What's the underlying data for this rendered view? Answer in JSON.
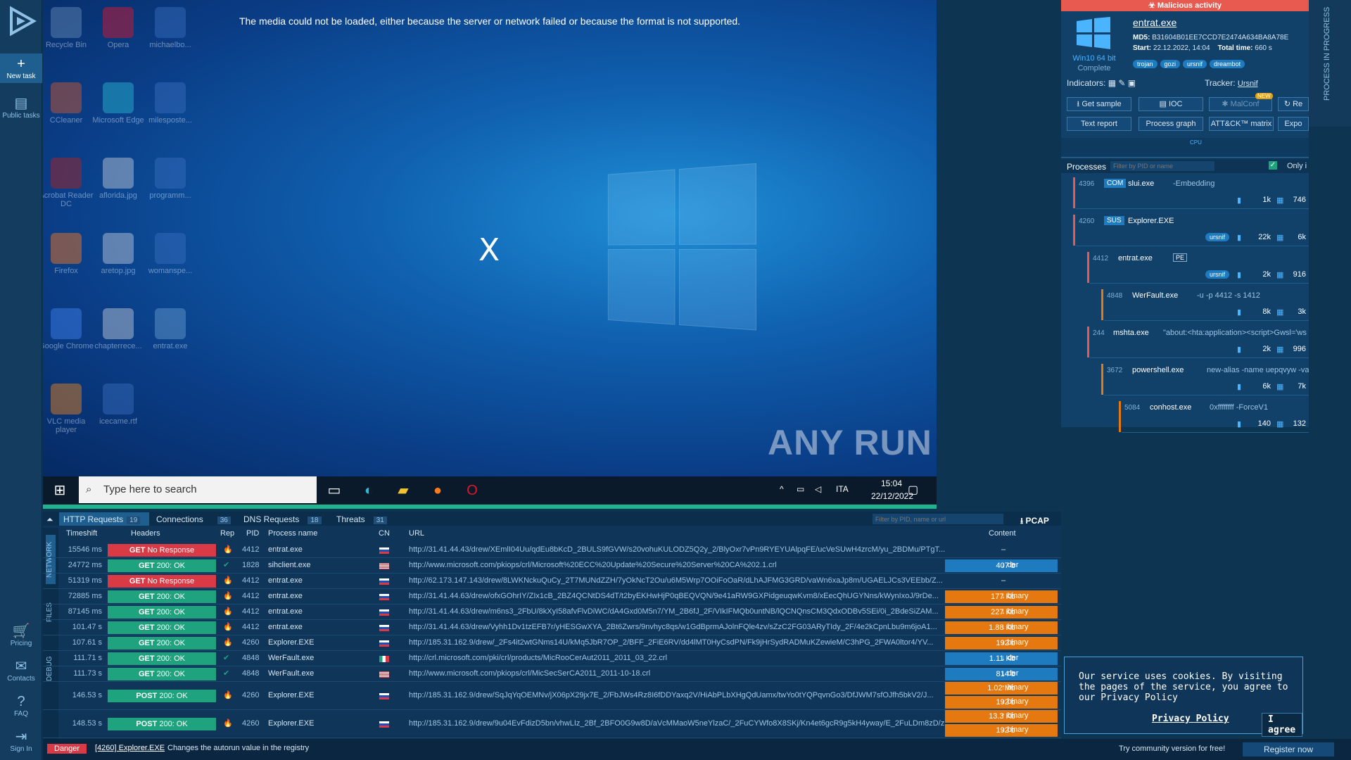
{
  "nav": {
    "new_task": "New task",
    "public_tasks": "Public tasks",
    "pricing": "Pricing",
    "contacts": "Contacts",
    "faq": "FAQ",
    "sign_in": "Sign In"
  },
  "vm": {
    "media_error": "The media could not be loaded, either because the server or network failed or because the format is not supported.",
    "close_x": "X",
    "watermark": "ANY RUN",
    "desktop_icons": [
      "Recycle Bin",
      "Opera",
      "michaelbo...",
      "CCleaner",
      "Microsoft Edge",
      "milesposte...",
      "Acrobat Reader DC",
      "aflorida.jpg",
      "programm...",
      "Firefox",
      "aretop.jpg",
      "womanspe...",
      "Google Chrome",
      "chapterrece...",
      "entrat.exe",
      "VLC media player",
      "icecame.rtf"
    ],
    "taskbar_search": "Type here to search",
    "tray_lang": "ITA",
    "tray_time": "15:04",
    "tray_date": "22/12/2022"
  },
  "panel": {
    "malicious": "Malicious activity",
    "filename": "entrat.exe",
    "md5_label": "MD5:",
    "md5": "B31604B01EE7CCD7E2474A634BA8A78E",
    "start_label": "Start:",
    "start": "22.12.2022, 14:04",
    "total_label": "Total time:",
    "total": "660 s",
    "os": "Win10 64 bit",
    "os_status": "Complete",
    "tags": [
      "trojan",
      "gozi",
      "ursnif",
      "dreambot"
    ],
    "indicators_label": "Indicators:",
    "tracker_label": "Tracker:",
    "tracker": "Ursnif",
    "btn_sample": "Get sample",
    "btn_ioc": "IOC",
    "btn_malconf": "MalConf",
    "btn_new": "NEW",
    "btn_re": "Re",
    "btn_text": "Text report",
    "btn_graph": "Process graph",
    "btn_attack": "ATT&CK™ matrix",
    "btn_expo": "Expo",
    "cpu": "CPU",
    "processes_label": "Processes",
    "filter_placeholder": "Filter by PID or name",
    "only_label": "Only i",
    "vertical_tab": "PROCESS IN PROGRESS"
  },
  "processes": [
    {
      "pid": "4396",
      "tag": "COM",
      "name": "slui.exe",
      "args": "-Embedding",
      "files": "1k",
      "reg": "746"
    },
    {
      "pid": "4260",
      "tag": "SUS",
      "name": "Explorer.EXE",
      "args": "",
      "badge": "ursnif",
      "files": "22k",
      "reg": "6k"
    },
    {
      "pid": "4412",
      "tag": "",
      "name": "entrat.exe",
      "args": "",
      "pe": "PE",
      "badge": "ursnif",
      "files": "2k",
      "reg": "916"
    },
    {
      "pid": "4848",
      "tag": "",
      "name": "WerFault.exe",
      "args": "-u -p 4412 -s 1412",
      "files": "8k",
      "reg": "3k"
    },
    {
      "pid": "244",
      "tag": "",
      "name": "mshta.exe",
      "args": "\"about:<hta:application><script>Gwsl='ws",
      "files": "2k",
      "reg": "996"
    },
    {
      "pid": "3672",
      "tag": "",
      "name": "powershell.exe",
      "args": "new-alias -name uepqvyw -value -",
      "files": "6k",
      "reg": "7k"
    },
    {
      "pid": "5084",
      "tag": "",
      "name": "conhost.exe",
      "args": "0xffffffff -ForceV1",
      "files": "140",
      "reg": "132"
    }
  ],
  "tabs": {
    "http": "HTTP Requests",
    "http_n": "19",
    "conn": "Connections",
    "conn_n": "36",
    "dns": "DNS Requests",
    "dns_n": "18",
    "threats": "Threats",
    "threats_n": "31",
    "filter": "Filter by PID, name or url",
    "pcap": "PCAP"
  },
  "cols": {
    "timeshift": "Timeshift",
    "headers": "Headers",
    "rep": "Rep",
    "pid": "PID",
    "pname": "Process name",
    "cn": "CN",
    "url": "URL",
    "content": "Content"
  },
  "side_labels": [
    "NETWORK",
    "FILES",
    "DEBUG"
  ],
  "rows": [
    {
      "t": "15546 ms",
      "m": "GET",
      "s": "No Response",
      "red": true,
      "pid": "4412",
      "p": "entrat.exe",
      "cn": "ru",
      "url": "http://31.41.44.43/drew/XEmlI04Uu/qdEu8bKcD_2BULS9fGVW/s20vohuKULODZ5Q2y_2/BlyOxr7vPn9RYEYUAlpqFE/ucVeSUwH4zrcM/yu_2BDMu/PTgT...",
      "c1": "–"
    },
    {
      "t": "24772 ms",
      "m": "GET",
      "s": "200: OK",
      "pid": "1828",
      "p": "sihclient.exe",
      "cn": "us",
      "url": "http://www.microsoft.com/pkiops/crl/Microsoft%20ECC%20Update%20Secure%20Server%20CA%202.1.crl",
      "c1": "407 b",
      "ct1": "der"
    },
    {
      "t": "51319 ms",
      "m": "GET",
      "s": "No Response",
      "red": true,
      "pid": "4412",
      "p": "entrat.exe",
      "cn": "ru",
      "url": "http://62.173.147.143/drew/8LWKNckuQuCy_2T7MUNdZZH/7yOkNcT2Ou/u6M5Wrp7OOiFoOaR/dLhAJFMG3GRD/vaWn6xaJp8m/UGAELJCs3VEEbb/Z...",
      "c1": "–"
    },
    {
      "t": "72885 ms",
      "m": "GET",
      "s": "200: OK",
      "pid": "4412",
      "p": "entrat.exe",
      "cn": "ru",
      "url": "http://31.41.44.63/drew/ofxGOhrIY/ZIx1cB_2BZ4QCNtDS4dT/t2byEKHwHjP0qBEQVQN/9e41aRW9GXPidgeuqwKvm8/xEecQhUGYNns/kWynIxoJ/9rDe...",
      "c1": "177 Kb",
      "ct1": "binary",
      "or": true
    },
    {
      "t": "87145 ms",
      "m": "GET",
      "s": "200: OK",
      "pid": "4412",
      "p": "entrat.exe",
      "cn": "ru",
      "url": "http://31.41.44.63/drew/m6ns3_2FbU/8kXyI58afvFlvDiWC/dA4Gxd0M5n7/YM_2B6fJ_2F/VIkIFMQb0untNB/lQCNQnsCM3QdxODBv5SEi/0i_2BdeSiZAM...",
      "c1": "227 Kb",
      "ct1": "binary",
      "or": true
    },
    {
      "t": "101.47 s",
      "m": "GET",
      "s": "200: OK",
      "pid": "4412",
      "p": "entrat.exe",
      "cn": "ru",
      "url": "http://31.41.44.63/drew/Vyhh1Dv1tzEFB7r/yHESGwXYA_2Bt6Zwrs/9nvhyc8qs/w1GdBprmAJolnFQle4zv/sZzC2FG03ARyTIdy_2F/4e2kCpnLbu9m6joA1...",
      "c1": "1.88 Kb",
      "ct1": "binary",
      "or": true
    },
    {
      "t": "107.61 s",
      "m": "GET",
      "s": "200: OK",
      "pid": "4260",
      "p": "Explorer.EXE",
      "cn": "ru",
      "url": "http://185.31.162.9/drew/_2Fs4it2wtGNms14U/kMq5JbR7OP_2/BFF_2FiE6RV/dd4lMT0HyCsdPN/Fk9jHrSydRADMuKZewieM/C3hPG_2FWA0ltor4/YV...",
      "c1": "192 b",
      "ct1": "binary",
      "or": true
    },
    {
      "t": "111.71 s",
      "m": "GET",
      "s": "200: OK",
      "pid": "4848",
      "p": "WerFault.exe",
      "cn": "it",
      "url": "http://crl.microsoft.com/pki/crl/products/MicRooCerAut2011_2011_03_22.crl",
      "c1": "1.11 Kb",
      "ct1": "der"
    },
    {
      "t": "111.73 s",
      "m": "GET",
      "s": "200: OK",
      "pid": "4848",
      "p": "WerFault.exe",
      "cn": "us",
      "url": "http://www.microsoft.com/pkiops/crl/MicSecSerCA2011_2011-10-18.crl",
      "c1": "814 b",
      "ct1": "der"
    },
    {
      "t": "146.53 s",
      "m": "POST",
      "s": "200: OK",
      "pid": "4260",
      "p": "Explorer.EXE",
      "cn": "ru",
      "url": "http://185.31.162.9/drew/SqJqYqOEMNv/jX06pX29jx7E_2/FbJWs4Rz8I6fDDYaxq2V/HiAbPLbXHgQdUamx/twYo0tYQPqvnGo3/DfJWM7sfOJfh5bkV2/J...",
      "c1": "1.02 Mb",
      "ct1": "binary",
      "c2": "192 b",
      "ct2": "binary",
      "or": true,
      "tall": true
    },
    {
      "t": "148.53 s",
      "m": "POST",
      "s": "200: OK",
      "pid": "4260",
      "p": "Explorer.EXE",
      "cn": "ru",
      "url": "http://185.31.162.9/drew/9u04EvFdizD5bn/vhwLIz_2Bf_2BFO0G9w8D/aVcMMaoW5neYlzaC/_2FuCYWfo8X8SKj/Kn4et6gcR9g5kH4yway/E_2FuLDm8zD/z...",
      "c1": "13.3 Kb",
      "ct1": "binary",
      "c2": "192 b",
      "ct2": "binary",
      "or": true,
      "tall": true
    }
  ],
  "status": {
    "danger": "Danger",
    "proc": "[4260] Explorer.EXE",
    "msg": "Changes the autorun value in the registry"
  },
  "cookie": {
    "text": "Our service uses cookies. By visiting the pages of the service, you agree to our Privacy Policy",
    "link": "Privacy Policy",
    "agree": "I agree"
  },
  "register": {
    "try": "Try community version for free!",
    "btn": "Register now"
  },
  "colors": {
    "accent": "#1f7bc0",
    "danger": "#d93a46",
    "ok": "#1fa37e",
    "binary": "#e5780f",
    "malicious": "#e85a4f"
  }
}
